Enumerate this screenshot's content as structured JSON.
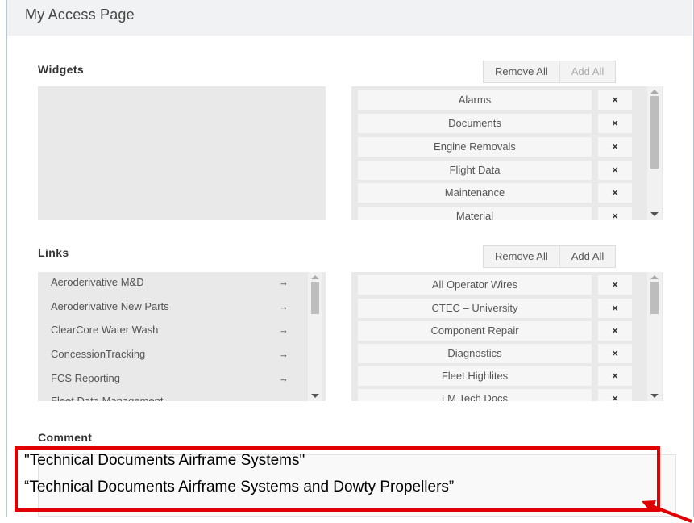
{
  "page": {
    "title": "My Access Page"
  },
  "widgets": {
    "label": "Widgets",
    "remove_all": "Remove All",
    "add_all": "Add All",
    "selected": [
      "Alarms",
      "Documents",
      "Engine Removals",
      "Flight Data",
      "Maintenance",
      "Material"
    ],
    "remove_symbol": "×"
  },
  "links": {
    "label": "Links",
    "remove_all": "Remove All",
    "add_all": "Add All",
    "available": [
      "Aeroderivative M&D",
      "Aeroderivative New Parts",
      "ClearCore Water Wash",
      "ConcessionTracking",
      "FCS Reporting",
      "Fleet Data Management"
    ],
    "add_symbol": "→",
    "selected": [
      "All Operator Wires",
      "CTEC – University",
      "Component Repair",
      "Diagnostics",
      "Fleet Highlites",
      "LM Tech Docs"
    ],
    "remove_symbol": "×"
  },
  "comment": {
    "label": "Comment",
    "callout_lines": [
      "\"Technical Documents  Airframe Systems\"",
      "“Technical Documents Airframe Systems and Dowty Propellers”"
    ]
  },
  "colors": {
    "callout": "#e00000",
    "panel": "#e9e9e9"
  }
}
